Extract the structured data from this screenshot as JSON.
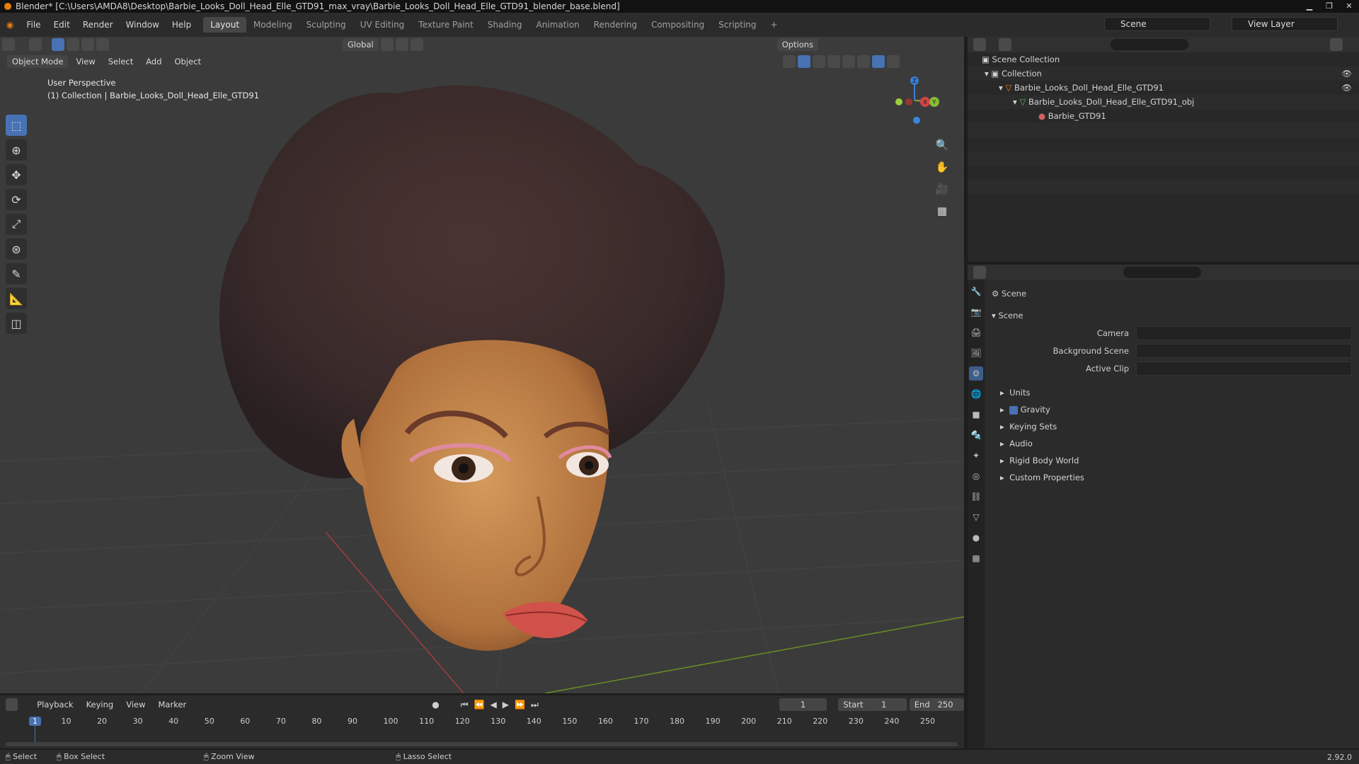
{
  "titlebar": {
    "title": "Blender* [C:\\Users\\AMDA8\\Desktop\\Barbie_Looks_Doll_Head_Elle_GTD91_max_vray\\Barbie_Looks_Doll_Head_Elle_GTD91_blender_base.blend]"
  },
  "menu": [
    "File",
    "Edit",
    "Render",
    "Window",
    "Help"
  ],
  "workspaces": [
    "Layout",
    "Modeling",
    "Sculpting",
    "UV Editing",
    "Texture Paint",
    "Shading",
    "Animation",
    "Rendering",
    "Compositing",
    "Scripting"
  ],
  "scene": "Scene",
  "view_layer": "View Layer",
  "viewport": {
    "mode": "Object Mode",
    "menus": [
      "View",
      "Select",
      "Add",
      "Object"
    ],
    "orientation": "Global",
    "options": "Options",
    "info_line1": "User Perspective",
    "info_line2": "(1) Collection | Barbie_Looks_Doll_Head_Elle_GTD91",
    "gizmo": {
      "z": "Z",
      "x": "X",
      "y": "Y"
    }
  },
  "outliner": {
    "root": "Scene Collection",
    "collection": "Collection",
    "object": "Barbie_Looks_Doll_Head_Elle_GTD91",
    "mesh": "Barbie_Looks_Doll_Head_Elle_GTD91_obj",
    "material": "Barbie_GTD91"
  },
  "properties": {
    "header": "Scene",
    "section": "Scene",
    "fields": [
      {
        "label": "Camera"
      },
      {
        "label": "Background Scene"
      },
      {
        "label": "Active Clip"
      }
    ],
    "subpanels": [
      "Units",
      "Gravity",
      "Keying Sets",
      "Audio",
      "Rigid Body World",
      "Custom Properties"
    ]
  },
  "timeline": {
    "menus": [
      "Playback",
      "Keying",
      "View",
      "Marker"
    ],
    "current_frame": "1",
    "start_label": "Start",
    "start": "1",
    "end_label": "End",
    "end": "250",
    "ticks": [
      "1",
      "10",
      "20",
      "30",
      "40",
      "50",
      "60",
      "70",
      "80",
      "90",
      "100",
      "110",
      "120",
      "130",
      "140",
      "150",
      "160",
      "170",
      "180",
      "190",
      "200",
      "210",
      "220",
      "230",
      "240",
      "250"
    ]
  },
  "status": {
    "select": "Select",
    "box_select": "Box Select",
    "zoom_view": "Zoom View",
    "lasso_select": "Lasso Select",
    "version": "2.92.0"
  }
}
